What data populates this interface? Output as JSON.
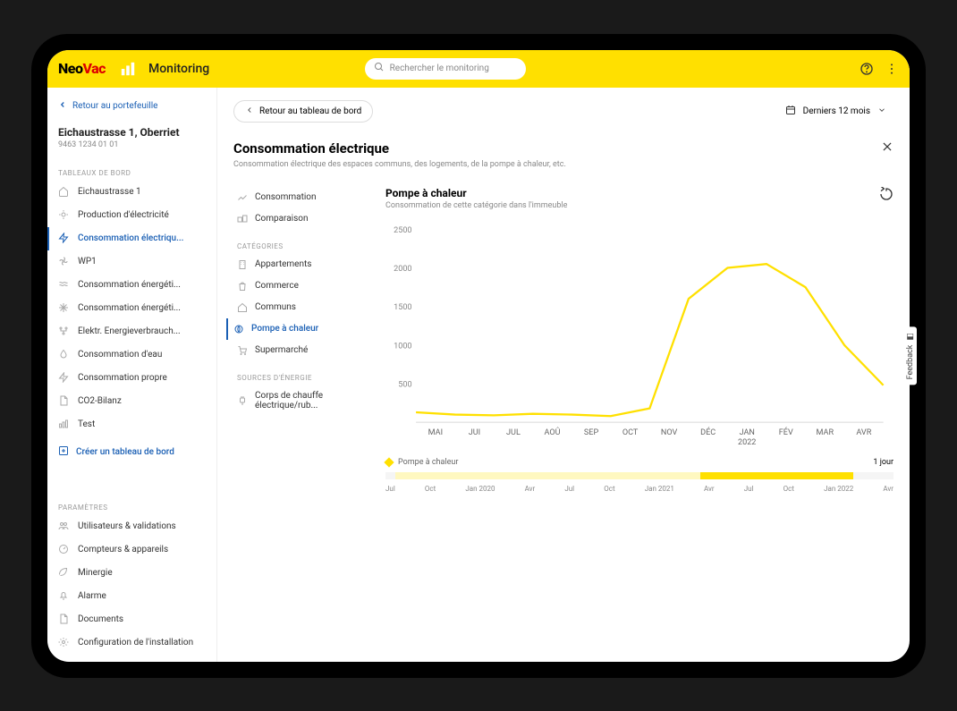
{
  "brand": {
    "part1": "Neo",
    "part2": "Vac"
  },
  "app_title": "Monitoring",
  "search": {
    "placeholder": "Rechercher le monitoring"
  },
  "back_portfolio": "Retour au portefeuille",
  "property": {
    "title": "Eichaustrasse 1, Oberriet",
    "subtitle": "9463 1234 01 01"
  },
  "sections": {
    "dashboards_label": "TABLEAUX DE BORD",
    "settings_label": "PARAMÈTRES"
  },
  "dashboards": [
    {
      "label": "Eichaustrasse 1",
      "icon": "home"
    },
    {
      "label": "Production d'électricité",
      "icon": "sun"
    },
    {
      "label": "Consommation électriqu...",
      "icon": "bolt",
      "active": true
    },
    {
      "label": "WP1",
      "icon": "fan"
    },
    {
      "label": "Consommation énergéti...",
      "icon": "waves"
    },
    {
      "label": "Consommation énergéti...",
      "icon": "snow"
    },
    {
      "label": "Elektr. Energieverbrauch...",
      "icon": "node"
    },
    {
      "label": "Consommation d'eau",
      "icon": "drop"
    },
    {
      "label": "Consommation propre",
      "icon": "bolt2"
    }
  ],
  "extra_boards": [
    {
      "label": "CO2-Bilanz",
      "icon": "doc"
    },
    {
      "label": "Test",
      "icon": "chart"
    }
  ],
  "create_dashboard": "Créer un tableau de bord",
  "settings_items": [
    {
      "label": "Utilisateurs & validations",
      "icon": "users"
    },
    {
      "label": "Compteurs & appareils",
      "icon": "meter"
    },
    {
      "label": "Minergie",
      "icon": "leaf"
    },
    {
      "label": "Alarme",
      "icon": "bell"
    },
    {
      "label": "Documents",
      "icon": "doc"
    },
    {
      "label": "Configuration de l'installation",
      "icon": "gear"
    }
  ],
  "main": {
    "back_button": "Retour au tableau de bord",
    "period_label": "Derniers 12 mois"
  },
  "detail": {
    "title": "Consommation électrique",
    "subtitle": "Consommation électrique des espaces communs, des logements, de la pompe à chaleur, etc.",
    "tabs": [
      {
        "label": "Consommation",
        "icon": "line"
      },
      {
        "label": "Comparaison",
        "icon": "compare"
      }
    ],
    "categories_label": "CATÉGORIES",
    "categories": [
      {
        "label": "Appartements",
        "icon": "building"
      },
      {
        "label": "Commerce",
        "icon": "bag"
      },
      {
        "label": "Communs",
        "icon": "house"
      },
      {
        "label": "Pompe à chaleur",
        "icon": "pump",
        "selected": true
      },
      {
        "label": "Supermarché",
        "icon": "cart"
      }
    ],
    "sources_label": "SOURCES D'ÉNERGIE",
    "sources": [
      {
        "label": "Corps de chauffe électrique/rub...",
        "icon": "plug"
      }
    ]
  },
  "chart": {
    "title": "Pompe à chaleur",
    "subtitle": "Consommation de cette catégorie dans l'immeuble",
    "legend": "Pompe à chaleur",
    "granularity": "1 jour"
  },
  "chart_data": {
    "type": "line",
    "categories": [
      "MAI",
      "JUI",
      "JUL",
      "AOÛ",
      "SEP",
      "OCT",
      "NOV",
      "DÉC",
      "JAN 2022",
      "FÉV",
      "MAR",
      "AVR"
    ],
    "values": [
      130,
      100,
      90,
      110,
      100,
      80,
      180,
      1600,
      2000,
      2050,
      1750,
      1000,
      480
    ],
    "title": "Pompe à chaleur",
    "xlabel": "",
    "ylabel": "",
    "ylim": [
      0,
      2500
    ],
    "y_ticks": [
      500,
      1000,
      1500,
      2000,
      2500
    ],
    "series_name": "Pompe à chaleur",
    "color": "#ffe000"
  },
  "brush_ticks": [
    "Jul",
    "Oct",
    "Jan 2020",
    "Avr",
    "Jul",
    "Oct",
    "Jan 2021",
    "Avr",
    "Jul",
    "Oct",
    "Jan 2022",
    "Avr"
  ],
  "feedback": "Feedback"
}
